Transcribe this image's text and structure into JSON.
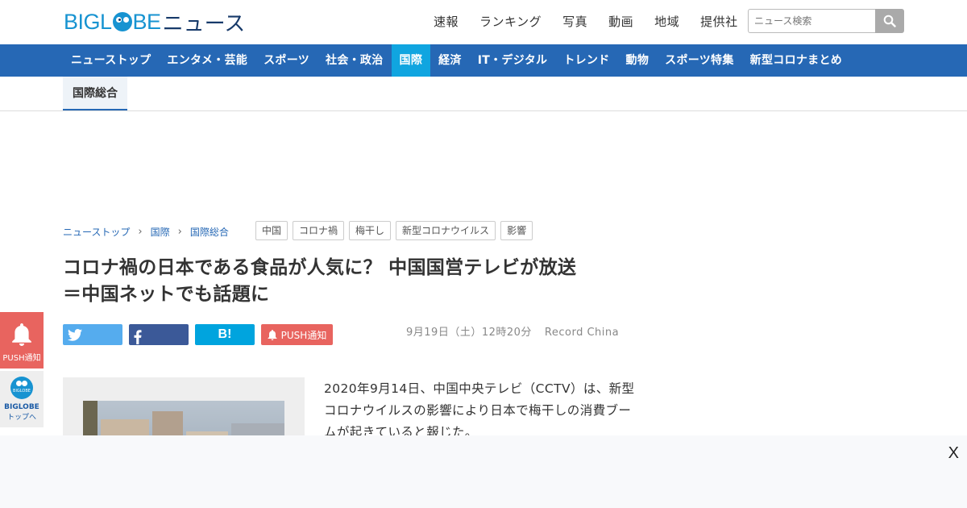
{
  "header": {
    "logo_brand": "BIGL",
    "logo_brand_end": "BE",
    "logo_news": "ニュース",
    "nav": [
      "速報",
      "ランキング",
      "写真",
      "動画",
      "地域",
      "提供社"
    ],
    "search_placeholder": "ニュース検索"
  },
  "categories": [
    {
      "label": "ニューストップ",
      "active": false
    },
    {
      "label": "エンタメ・芸能",
      "active": false
    },
    {
      "label": "スポーツ",
      "active": false
    },
    {
      "label": "社会・政治",
      "active": false
    },
    {
      "label": "国際",
      "active": true
    },
    {
      "label": "経済",
      "active": false
    },
    {
      "label": "IT・デジタル",
      "active": false
    },
    {
      "label": "トレンド",
      "active": false
    },
    {
      "label": "動物",
      "active": false
    },
    {
      "label": "スポーツ特集",
      "active": false
    },
    {
      "label": "新型コロナまとめ",
      "active": false
    }
  ],
  "subtab": "国際総合",
  "breadcrumb": [
    "ニューストップ",
    "国際",
    "国際総合"
  ],
  "tags": [
    "中国",
    "コロナ禍",
    "梅干し",
    "新型コロナウイルス",
    "影響"
  ],
  "article": {
    "title_line1": "コロナ禍の日本である食品が人気に？ 中国国営テレビが放送",
    "title_line2": "＝中国ネットでも話題に",
    "date": "9月19日（土）12時20分",
    "source": "Record China",
    "body": "2020年9月14日、中国中央テレビ（CCTV）は、新型コロナウイルスの影響により日本で梅干しの消費ブームが起きていると報じた。"
  },
  "share": {
    "hatena": "B!",
    "push": "PUSH通知"
  },
  "float": {
    "push_label": "PUSH通知",
    "top_ball": "BIGLOBE",
    "top_l1": "BIGLOBE",
    "top_l2": "トップへ"
  },
  "overlay": {
    "close": "X"
  },
  "colors": {
    "brand_blue": "#1793d1",
    "nav_bar": "#2668b5",
    "nav_active": "#10a5e0",
    "push_red": "#e8645f"
  }
}
